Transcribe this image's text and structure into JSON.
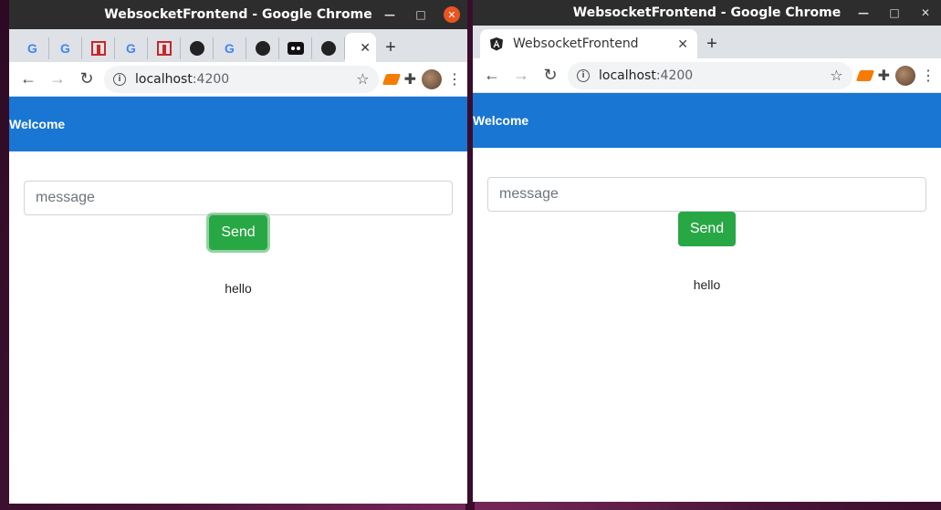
{
  "windows": {
    "left": {
      "title": "WebsocketFrontend - Google Chrome",
      "tabs": [
        {
          "icon": "google-icon",
          "glyph": "G"
        },
        {
          "icon": "google-icon",
          "glyph": "G"
        },
        {
          "icon": "m-logo-icon"
        },
        {
          "icon": "google-icon",
          "glyph": "G"
        },
        {
          "icon": "m-logo-icon"
        },
        {
          "icon": "github-icon"
        },
        {
          "icon": "google-icon",
          "glyph": "G"
        },
        {
          "icon": "github-icon"
        },
        {
          "icon": "medium-icon"
        },
        {
          "icon": "github-icon"
        }
      ],
      "active_tab_close": "✕",
      "url_host": "localhost",
      "url_port": ":4200"
    },
    "right": {
      "title": "WebsocketFrontend - Google Chrome",
      "tab_title": "WebsocketFrontend",
      "tab_close": "✕",
      "url_host": "localhost",
      "url_port": ":4200"
    }
  },
  "app": {
    "header_title": "Welcome",
    "input_placeholder": "message",
    "send_label": "Send",
    "messages": [
      "hello"
    ]
  },
  "glyphs": {
    "newtab": "+",
    "back": "←",
    "forward": "→",
    "reload": "↻",
    "star": "☆",
    "puzzle": "✚",
    "menu": "⋮",
    "minimize": "—",
    "maximize": "□",
    "close": "✕",
    "info": "i"
  },
  "colors": {
    "header_blue": "#1976d2",
    "send_green": "#28a745",
    "ubuntu_orange": "#e95420"
  }
}
